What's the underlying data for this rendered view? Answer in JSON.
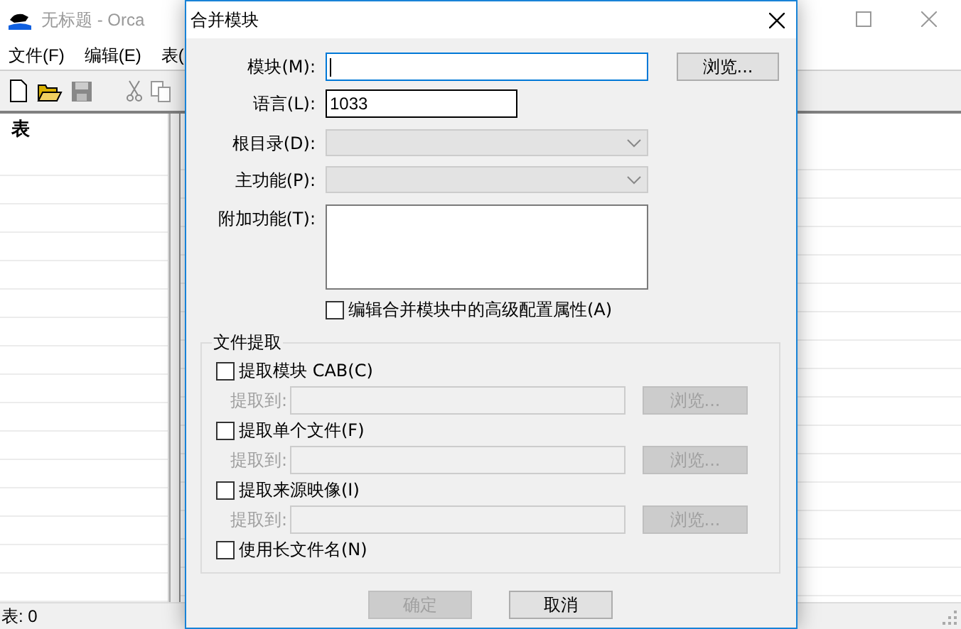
{
  "app_window": {
    "title": "无标题 - Orca",
    "menu": [
      "文件(F)",
      "编辑(E)",
      "表("
    ],
    "tables_pane": {
      "header": "表"
    },
    "status_bar": {
      "text": "表: 0"
    }
  },
  "dialog": {
    "title": "合并模块",
    "fields": [
      {
        "kind": "text",
        "label": "模块(M):",
        "focused": true,
        "disabled": false,
        "browse": "浏览..."
      },
      {
        "kind": "text",
        "label": "语言(L):",
        "value": "1033",
        "focused": false,
        "disabled": false
      },
      {
        "kind": "combo",
        "label": "根目录(D):",
        "focused": false,
        "disabled": true
      },
      {
        "kind": "combo",
        "label": "主功能(P):",
        "focused": false,
        "disabled": true
      },
      {
        "kind": "textarea",
        "label": "附加功能(T):",
        "focused": false,
        "disabled": false
      }
    ],
    "advanced": {
      "label": "编辑合并模块中的高级配置属性(A)",
      "checked": false
    },
    "file_extraction": {
      "caption": "文件提取",
      "options": [
        {
          "label": "提取模块 CAB(C)",
          "checked": false,
          "extract_to": {
            "label": "提取到:",
            "disabled": true,
            "browse": "浏览..."
          }
        },
        {
          "label": "提取单个文件(F)",
          "checked": false,
          "extract_to": {
            "label": "提取到:",
            "disabled": true,
            "browse": "浏览..."
          }
        },
        {
          "label": "提取来源映像(I)",
          "checked": false,
          "extract_to": {
            "label": "提取到:",
            "disabled": true,
            "browse": "浏览..."
          }
        },
        {
          "label": "使用长文件名(N)",
          "checked": false
        }
      ]
    },
    "buttons": [
      {
        "label": "确定",
        "disabled": true
      },
      {
        "label": "取消",
        "disabled": false
      }
    ]
  }
}
